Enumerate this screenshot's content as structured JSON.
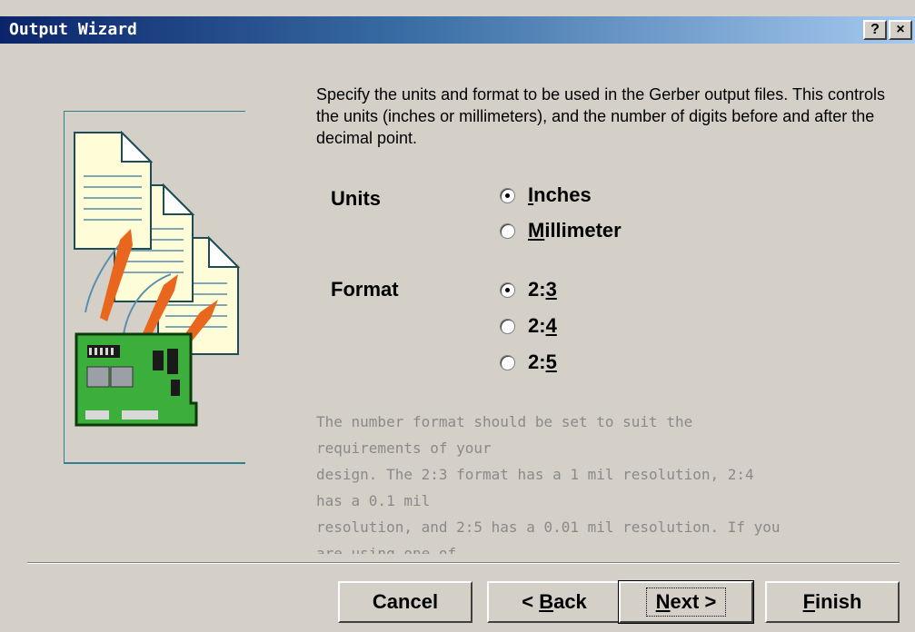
{
  "window": {
    "title": "Output Wizard",
    "help_label": "?",
    "close_label": "×"
  },
  "intro_text": "Specify the units and format to be used in the Gerber output files. This controls the units (inches or millimeters), and the number of digits before and after the decimal point.",
  "units": {
    "label": "Units",
    "options": [
      {
        "prefix": "",
        "mnemonic": "I",
        "rest": "nches",
        "selected": true
      },
      {
        "prefix": "",
        "mnemonic": "M",
        "rest": "illimeter",
        "selected": false
      }
    ]
  },
  "format": {
    "label": "Format",
    "options": [
      {
        "prefix": "2:",
        "mnemonic": "3",
        "rest": "",
        "selected": true
      },
      {
        "prefix": "2:",
        "mnemonic": "4",
        "rest": "",
        "selected": false
      },
      {
        "prefix": "2:",
        "mnemonic": "5",
        "rest": "",
        "selected": false
      }
    ]
  },
  "description": "The number format should be set to suit the\nrequirements of your\ndesign. The 2:3 format has a 1 mil resolution, 2:4\nhas a 0.1 mil\nresolution, and 2:5 has a 0.01 mil resolution. If you\nare using one of",
  "buttons": {
    "cancel": "Cancel",
    "back_arrow": "<",
    "back_mnemonic": "B",
    "back_rest": "ack",
    "next_mnemonic": "N",
    "next_rest": "ext",
    "next_arrow": ">",
    "finish_mnemonic": "F",
    "finish_rest": "inish"
  },
  "colors": {
    "titlebar_start": "#0a246a",
    "titlebar_end": "#a6caf0",
    "dialog_bg": "#d4d0c8",
    "pcb_green": "#3cae3c",
    "arrow_orange": "#e8661e"
  },
  "icons": [
    "documents-icon",
    "pcb-board-icon",
    "output-arrow-icon"
  ]
}
